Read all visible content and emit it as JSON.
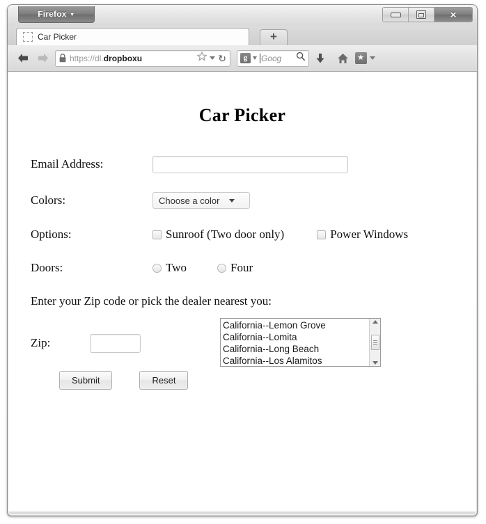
{
  "window": {
    "app_menu_button": "Firefox",
    "controls": {
      "minimize": "minimize-icon",
      "restore": "restore-icon",
      "close": "×"
    }
  },
  "tabs": {
    "items": [
      {
        "title": "Car Picker",
        "favicon": "blank-favicon"
      }
    ],
    "new_tab_label": "+"
  },
  "toolbar": {
    "back_icon": "back-arrow-icon",
    "forward_icon": "forward-arrow-icon",
    "url": {
      "lock_icon": "lock-icon",
      "scheme_host": "https://dl.",
      "domain_bold": "dropboxu",
      "bookmark_star_icon": "star-icon",
      "dropdown_icon": "chevron-down-icon",
      "reload_icon": "↻"
    },
    "search": {
      "engine_icon": "google-g-icon",
      "engine_letter": "g",
      "engine_dropdown_icon": "chevron-down-icon",
      "placeholder": "Goog",
      "magnifier_icon": "search-icon"
    },
    "downloads_icon": "download-arrow-icon",
    "home_icon": "home-icon",
    "bookmarks_icon": "bookmarks-star-icon",
    "bookmarks_star_glyph": "★",
    "bookmarks_dropdown_icon": "chevron-down-icon"
  },
  "page": {
    "title": "Car Picker",
    "fields": {
      "email_label": "Email Address:",
      "email_value": "",
      "colors_label": "Colors:",
      "colors_selected": "Choose a color",
      "options_label": "Options:",
      "option_sunroof": "Sunroof (Two door only)",
      "option_power_windows": "Power Windows",
      "doors_label": "Doors:",
      "door_two": "Two",
      "door_four": "Four",
      "dealer_prompt": "Enter your Zip code or pick the dealer nearest you:",
      "zip_label": "Zip:",
      "zip_value": ""
    },
    "dealer_list": [
      "California--Lemon Grove",
      "California--Lomita",
      "California--Long Beach",
      "California--Los Alamitos"
    ],
    "buttons": {
      "submit": "Submit",
      "reset": "Reset"
    }
  }
}
